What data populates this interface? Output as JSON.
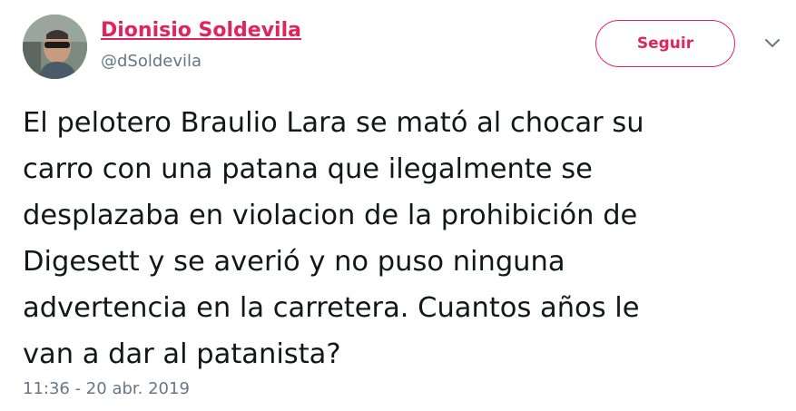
{
  "author": {
    "display_name": "Dionisio Soldevila",
    "handle": "@dSoldevila",
    "avatar_icon": "user-avatar-photo"
  },
  "actions": {
    "follow_label": "Seguir",
    "more_icon": "chevron-down-icon"
  },
  "tweet": {
    "text": "El pelotero Braulio Lara se mató al chocar su\ncarro con una patana que ilegalmente se\ndesplazaba en violacion de la prohibición de\nDigesett y se averió y no puso ninguna\nadvertencia en la carretera. Cuantos años le\nvan a dar al patanista?",
    "timestamp": "11:36 - 20 abr. 2019"
  },
  "colors": {
    "accent": "#e0245e",
    "text": "#14171a",
    "muted": "#657786"
  }
}
